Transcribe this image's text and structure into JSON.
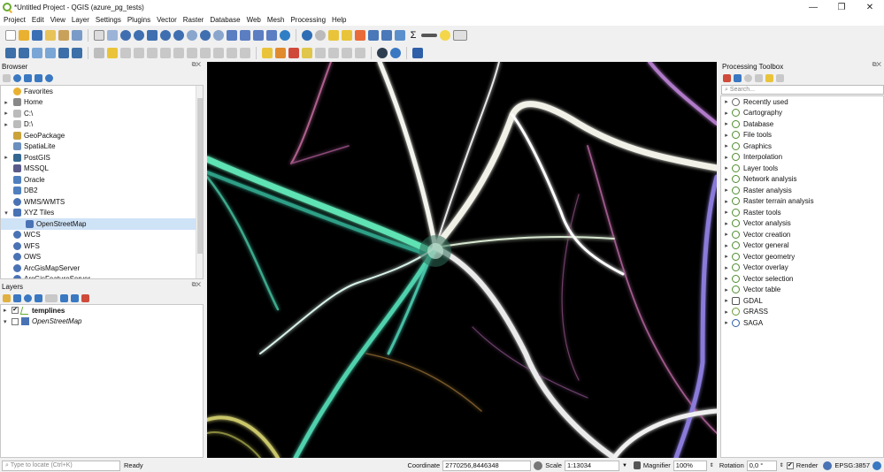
{
  "window": {
    "title": "*Untitled Project - QGIS (azure_pg_tests)",
    "controls": [
      "—",
      "❐",
      "✕"
    ]
  },
  "menu": [
    "Project",
    "Edit",
    "View",
    "Layer",
    "Settings",
    "Plugins",
    "Vector",
    "Raster",
    "Database",
    "Web",
    "Mesh",
    "Processing",
    "Help"
  ],
  "browser": {
    "title": "Browser",
    "items": [
      {
        "label": "Favorites",
        "icon": "star-icon",
        "color": "#e9b12f",
        "arrow": ""
      },
      {
        "label": "Home",
        "icon": "home-icon",
        "color": "#888888",
        "arrow": "▸"
      },
      {
        "label": "C:\\",
        "icon": "drive-icon",
        "color": "#bbbbbb",
        "arrow": "▸"
      },
      {
        "label": "D:\\",
        "icon": "drive-icon",
        "color": "#bbbbbb",
        "arrow": "▸"
      },
      {
        "label": "GeoPackage",
        "icon": "geopackage-icon",
        "color": "#caa33a",
        "arrow": ""
      },
      {
        "label": "SpatiaLite",
        "icon": "spatialite-icon",
        "color": "#6b8fbf",
        "arrow": ""
      },
      {
        "label": "PostGIS",
        "icon": "postgis-icon",
        "color": "#336791",
        "arrow": "▸"
      },
      {
        "label": "MSSQL",
        "icon": "mssql-icon",
        "color": "#5a5a8a",
        "arrow": ""
      },
      {
        "label": "Oracle",
        "icon": "oracle-icon",
        "color": "#4f7fbf",
        "arrow": ""
      },
      {
        "label": "DB2",
        "icon": "db2-icon",
        "color": "#4f7fbf",
        "arrow": ""
      },
      {
        "label": "WMS/WMTS",
        "icon": "globe-icon",
        "color": "#4a73b5",
        "arrow": ""
      },
      {
        "label": "XYZ Tiles",
        "icon": "xyz-tiles-icon",
        "color": "#4a73b5",
        "arrow": "▾"
      },
      {
        "label": "OpenStreetMap",
        "icon": "tiles-icon",
        "color": "#4a73b5",
        "arrow": "",
        "indent": true,
        "selected": true
      },
      {
        "label": "WCS",
        "icon": "globe-icon",
        "color": "#4a73b5",
        "arrow": ""
      },
      {
        "label": "WFS",
        "icon": "globe-icon",
        "color": "#4a73b5",
        "arrow": ""
      },
      {
        "label": "OWS",
        "icon": "globe-icon",
        "color": "#4a73b5",
        "arrow": ""
      },
      {
        "label": "ArcGisMapServer",
        "icon": "globe-icon",
        "color": "#4a73b5",
        "arrow": ""
      },
      {
        "label": "ArcGisFeatureServer",
        "icon": "globe-icon",
        "color": "#4a73b5",
        "arrow": ""
      }
    ]
  },
  "layers": {
    "title": "Layers",
    "items": [
      {
        "label": "templines",
        "checked": "✔",
        "style": "bold",
        "icon": "line-layer-icon"
      },
      {
        "label": "OpenStreetMap",
        "checked": "",
        "style": "ital",
        "icon": "raster-layer-icon"
      }
    ]
  },
  "toolbox": {
    "title": "Processing Toolbox",
    "search_placeholder": "Search...",
    "items": [
      "Recently used",
      "Cartography",
      "Database",
      "File tools",
      "Graphics",
      "Interpolation",
      "Layer tools",
      "Network analysis",
      "Raster analysis",
      "Raster terrain analysis",
      "Raster tools",
      "Vector analysis",
      "Vector creation",
      "Vector general",
      "Vector geometry",
      "Vector overlay",
      "Vector selection",
      "Vector table",
      "GDAL",
      "GRASS",
      "SAGA"
    ]
  },
  "status": {
    "locate_placeholder": "Type to locate (Ctrl+K)",
    "ready": "Ready",
    "coordinate_label": "Coordinate",
    "coordinate_value": "2770256,8446348",
    "scale_label": "Scale",
    "scale_value": "1:13034",
    "magnifier_label": "Magnifier",
    "magnifier_value": "100%",
    "rotation_label": "Rotation",
    "rotation_value": "0,0 °",
    "render_label": "Render",
    "crs": "EPSG:3857"
  }
}
